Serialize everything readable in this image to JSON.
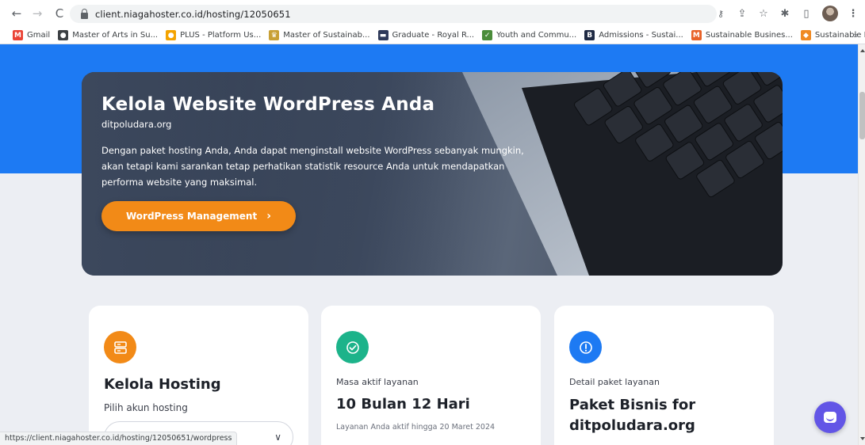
{
  "browser": {
    "url": "client.niagahoster.co.id/hosting/12050651",
    "status_url": "https://client.niagahoster.co.id/hosting/12050651/wordpress"
  },
  "bookmarks": [
    {
      "label": "Gmail",
      "icon": "gmail-icon",
      "color": "#ea4335",
      "glyph": "M"
    },
    {
      "label": "Master of Arts in Su...",
      "icon": "globe-icon",
      "color": "#3c4043",
      "glyph": "●"
    },
    {
      "label": "PLUS - Platform Us...",
      "icon": "plus-platform-icon",
      "color": "#f4a300",
      "glyph": "●"
    },
    {
      "label": "Master of Sustainab...",
      "icon": "university-crest-icon",
      "color": "#c8a035",
      "glyph": "♛"
    },
    {
      "label": "Graduate - Royal R...",
      "icon": "royal-roads-icon",
      "color": "#2f3a5a",
      "glyph": "▬"
    },
    {
      "label": "Youth and Commu...",
      "icon": "check-circle-icon",
      "color": "#4a8c3a",
      "glyph": "✓"
    },
    {
      "label": "Admissions - Sustai...",
      "icon": "admissions-icon",
      "color": "#1f2a44",
      "glyph": "B"
    },
    {
      "label": "Sustainable Busines...",
      "icon": "sustainable-business-icon",
      "color": "#e8632a",
      "glyph": "M"
    },
    {
      "label": "Sustainable Entrepr...",
      "icon": "sustainable-entrepreneurship-icon",
      "color": "#f08a24",
      "glyph": "◆"
    }
  ],
  "bookmarks_more": "»",
  "hero": {
    "title": "Kelola Website WordPress Anda",
    "domain": "ditpoludara.org",
    "description": "Dengan paket hosting Anda, Anda dapat menginstall website WordPress sebanyak mungkin, akan tetapi kami sarankan tetap perhatikan statistik resource Anda untuk mendapatkan performa website yang maksimal.",
    "button_label": "WordPress Management",
    "button_icon": "chevron-right-icon"
  },
  "cards": {
    "hosting": {
      "title": "Kelola Hosting",
      "subtitle": "Pilih akun hosting",
      "select_value": "",
      "icon": "server-icon",
      "icon_color": "#f28a17"
    },
    "active": {
      "label": "Masa aktif layanan",
      "value": "10 Bulan 12 Hari",
      "note": "Layanan Anda aktif hingga 20 Maret 2024",
      "icon": "check-circle-icon",
      "icon_color": "#1cb38a"
    },
    "package": {
      "label": "Detail paket layanan",
      "title": "Paket Bisnis for ditpoludara.org",
      "icon": "info-circle-icon",
      "icon_color": "#1d7af3"
    }
  },
  "colors": {
    "blue_band": "#1d7af3",
    "accent_orange": "#f28a17",
    "chat": "#6255e6"
  }
}
